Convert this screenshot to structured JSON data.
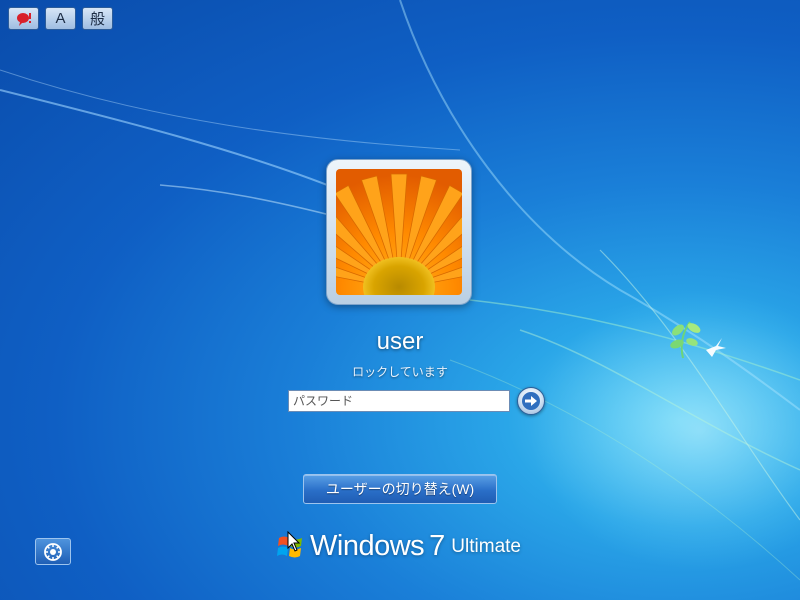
{
  "ime_toolbar": {
    "mode_char": "A",
    "general_char": "般"
  },
  "user": {
    "name": "user",
    "status": "ロックしています"
  },
  "password": {
    "placeholder": "パスワード",
    "value": ""
  },
  "switch_user": {
    "label": "ユーザーの切り替え(W)"
  },
  "branding": {
    "product": "Windows",
    "version": "7",
    "edition": "Ultimate"
  },
  "colors": {
    "background": "#1a7fd8",
    "button": "#2a6fc8",
    "flower": "#ff8c00"
  },
  "icons": {
    "ime_language": "red-balloon-icon",
    "submit": "arrow-right-icon",
    "ease_of_access": "ease-of-access-icon",
    "logo": "windows-flag-icon"
  }
}
